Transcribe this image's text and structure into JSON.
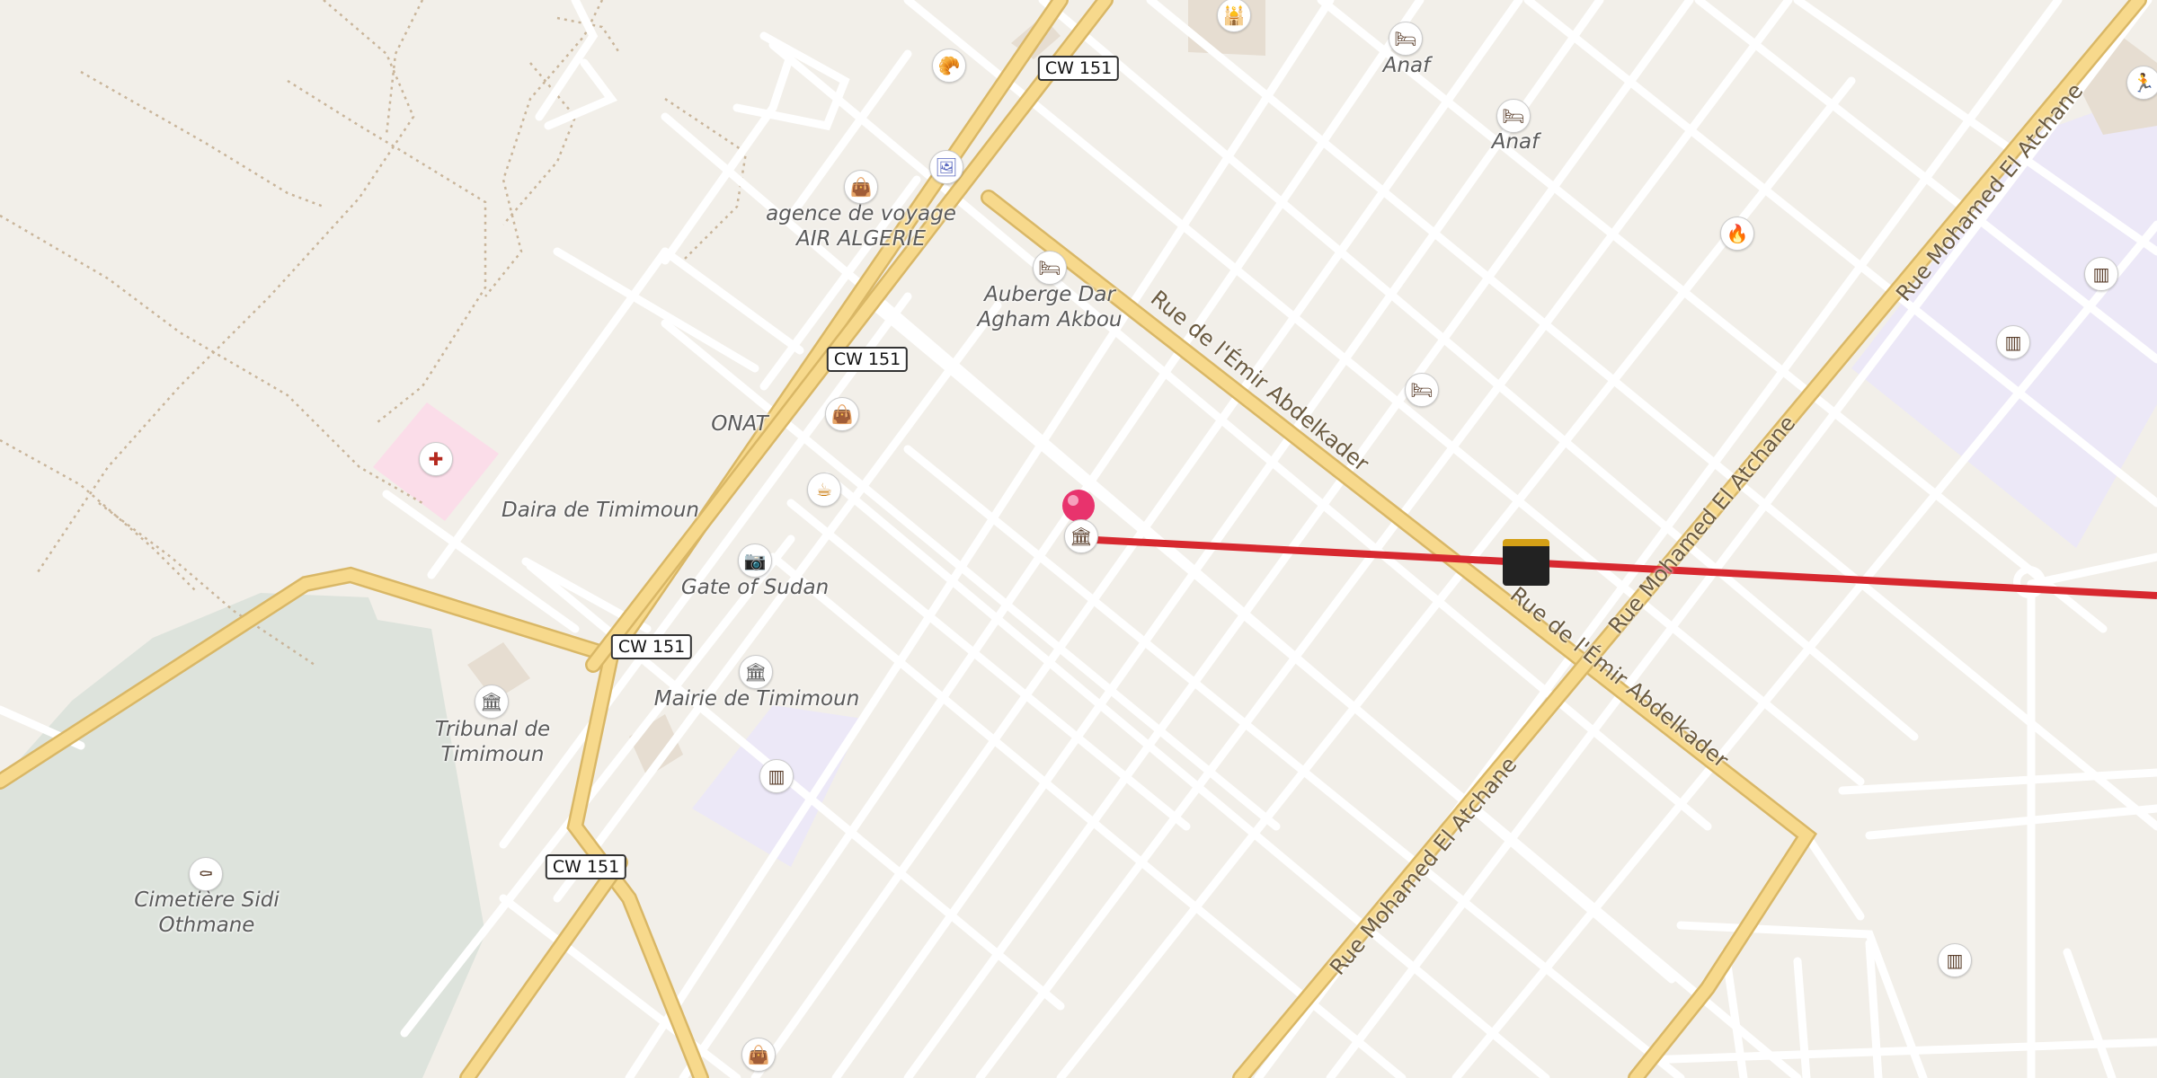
{
  "map": {
    "places": [
      {
        "id": "anaf-1",
        "text": "Anaf"
      },
      {
        "id": "anaf-2",
        "text": "Anaf"
      },
      {
        "id": "air-algerie",
        "text": "agence de voyage\nAIR ALGERIE"
      },
      {
        "id": "auberge",
        "text": "Auberge Dar\nAgham Akbou"
      },
      {
        "id": "onat",
        "text": "ONAT"
      },
      {
        "id": "daira",
        "text": "Daira de Timimoun"
      },
      {
        "id": "gate",
        "text": "Gate of Sudan"
      },
      {
        "id": "mairie",
        "text": "Mairie de Timimoun"
      },
      {
        "id": "tribunal",
        "text": "Tribunal de\nTimimoun"
      },
      {
        "id": "cimetiere",
        "text": "Cimetière Sidi\nOthmane"
      }
    ],
    "shields": [
      "CW 151",
      "CW 151",
      "CW 151",
      "CW 151"
    ],
    "street_labels": [
      "Rue de l'Émir Abdelkader",
      "Rue de l'Émir Abdelkader",
      "Rue Mohamed El Atchane",
      "Rue Mohamed El Atchane",
      "Rue Mohamed El Atchane"
    ],
    "poi_icons": [
      "bakery-icon",
      "gallery-icon",
      "shopping-bag-icon",
      "hotel-icon",
      "hotel-icon",
      "hotel-icon",
      "hotel-icon",
      "shopping-bag-icon",
      "cafe-icon",
      "camera-icon",
      "townhall-icon",
      "townhall-icon",
      "school-icon",
      "school-icon",
      "school-icon",
      "school-icon",
      "cemetery-icon",
      "hospital-icon",
      "fire-station-icon",
      "worship-icon",
      "sports-icon",
      "shopping-bag-icon",
      "monument-icon",
      "mosque-kaaba-icon"
    ],
    "colors": {
      "background": "#f2efe9",
      "primary_road": "#f7d98c",
      "minor_road": "#ffffff",
      "route_line": "#d7282f",
      "marker": "#e8336d",
      "hospital_area": "#fbdde9",
      "school_area": "#ece8f7",
      "cemetery_area": "#dde3dc"
    }
  }
}
